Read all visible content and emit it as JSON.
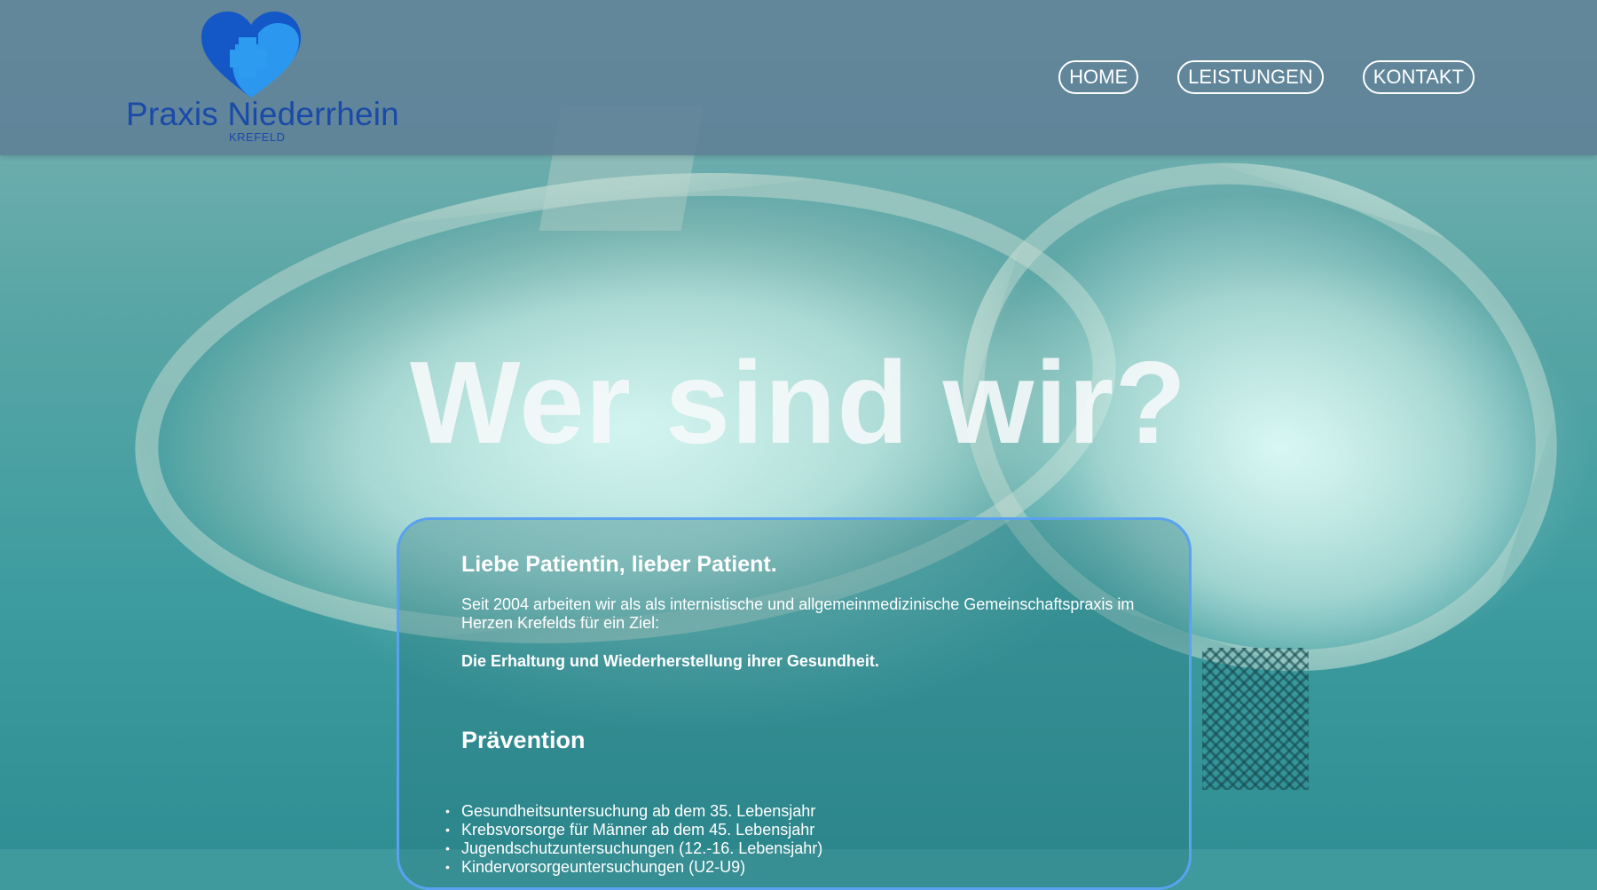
{
  "brand": {
    "name": "Praxis Niederrhein",
    "city": "KREFELD",
    "primary_color": "#1a4aa8",
    "accent_color": "#2c9bf0"
  },
  "nav": {
    "items": [
      {
        "label": "HOME"
      },
      {
        "label": "LEISTUNGEN"
      },
      {
        "label": "KONTAKT"
      }
    ]
  },
  "hero": {
    "title": "Wer sind wir?"
  },
  "intro": {
    "heading": "Liebe Patientin, lieber Patient.",
    "paragraph": "Seit 2004 arbeiten wir als als internistische und allgemeinmedizinische Gemeinschaftspraxis im Herzen Krefelds für ein Ziel:",
    "goal": "Die Erhaltung und Wiederherstellung ihrer Gesundheit."
  },
  "prevention": {
    "heading": "Prävention",
    "items": [
      "Gesundheitsuntersuchung ab dem 35. Lebensjahr",
      "Krebsvorsorge für Männer ab dem 45. Lebensjahr",
      "Jugendschutzuntersuchungen (12.-16. Lebensjahr)",
      "Kindervorsorgeuntersuchungen (U2-U9)"
    ]
  },
  "colors": {
    "header_bg": "#5f8096",
    "card_border": "#5aa2f0",
    "text": "#ffffff"
  }
}
